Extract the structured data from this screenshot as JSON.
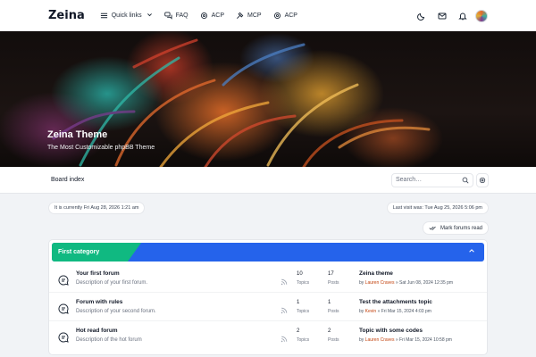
{
  "nav": {
    "logo": "Zeina",
    "quick_links": "Quick links",
    "faq": "FAQ",
    "acp": "ACP",
    "mcp": "MCP",
    "acp2": "ACP"
  },
  "hero": {
    "title": "Zeina Theme",
    "subtitle": "The Most Customizable phpBB Theme"
  },
  "breadcrumb": {
    "board_index": "Board index",
    "search_placeholder": "Search…"
  },
  "info": {
    "current_time": "It is currently Fri Aug 28, 2026 1:21 am",
    "last_visit": "Last visit was: Tue Aug 25, 2026 5:06 pm",
    "mark_read": "Mark forums read"
  },
  "category": {
    "title": "First category",
    "forums": [
      {
        "name": "Your first forum",
        "description": "Description of your first forum.",
        "topics": "10",
        "topics_label": "Topics",
        "posts": "17",
        "posts_label": "Posts",
        "last_title": "Zeina theme",
        "last_by": "by",
        "last_author": "Lauren Craves",
        "last_date": "» Sat Jun 08, 2024 12:35 pm"
      },
      {
        "name": "Forum with rules",
        "description": "Description of your second forum.",
        "topics": "1",
        "topics_label": "Topics",
        "posts": "1",
        "posts_label": "Posts",
        "last_title": "Test the attachments topic",
        "last_by": "by",
        "last_author": "Kevin",
        "last_date": "» Fri Mar 15, 2024 4:03 pm"
      },
      {
        "name": "Hot read forum",
        "description": "Description of the hot forum",
        "topics": "2",
        "topics_label": "Topics",
        "posts": "2",
        "posts_label": "Posts",
        "last_title": "Topic with some codes",
        "last_by": "by",
        "last_author": "Lauren Craves",
        "last_date": "» Fri Mar 15, 2024 10:58 pm"
      }
    ]
  },
  "colors": {
    "category_blue": "#2563eb",
    "category_green": "#10b981",
    "author": "#c2410c"
  }
}
